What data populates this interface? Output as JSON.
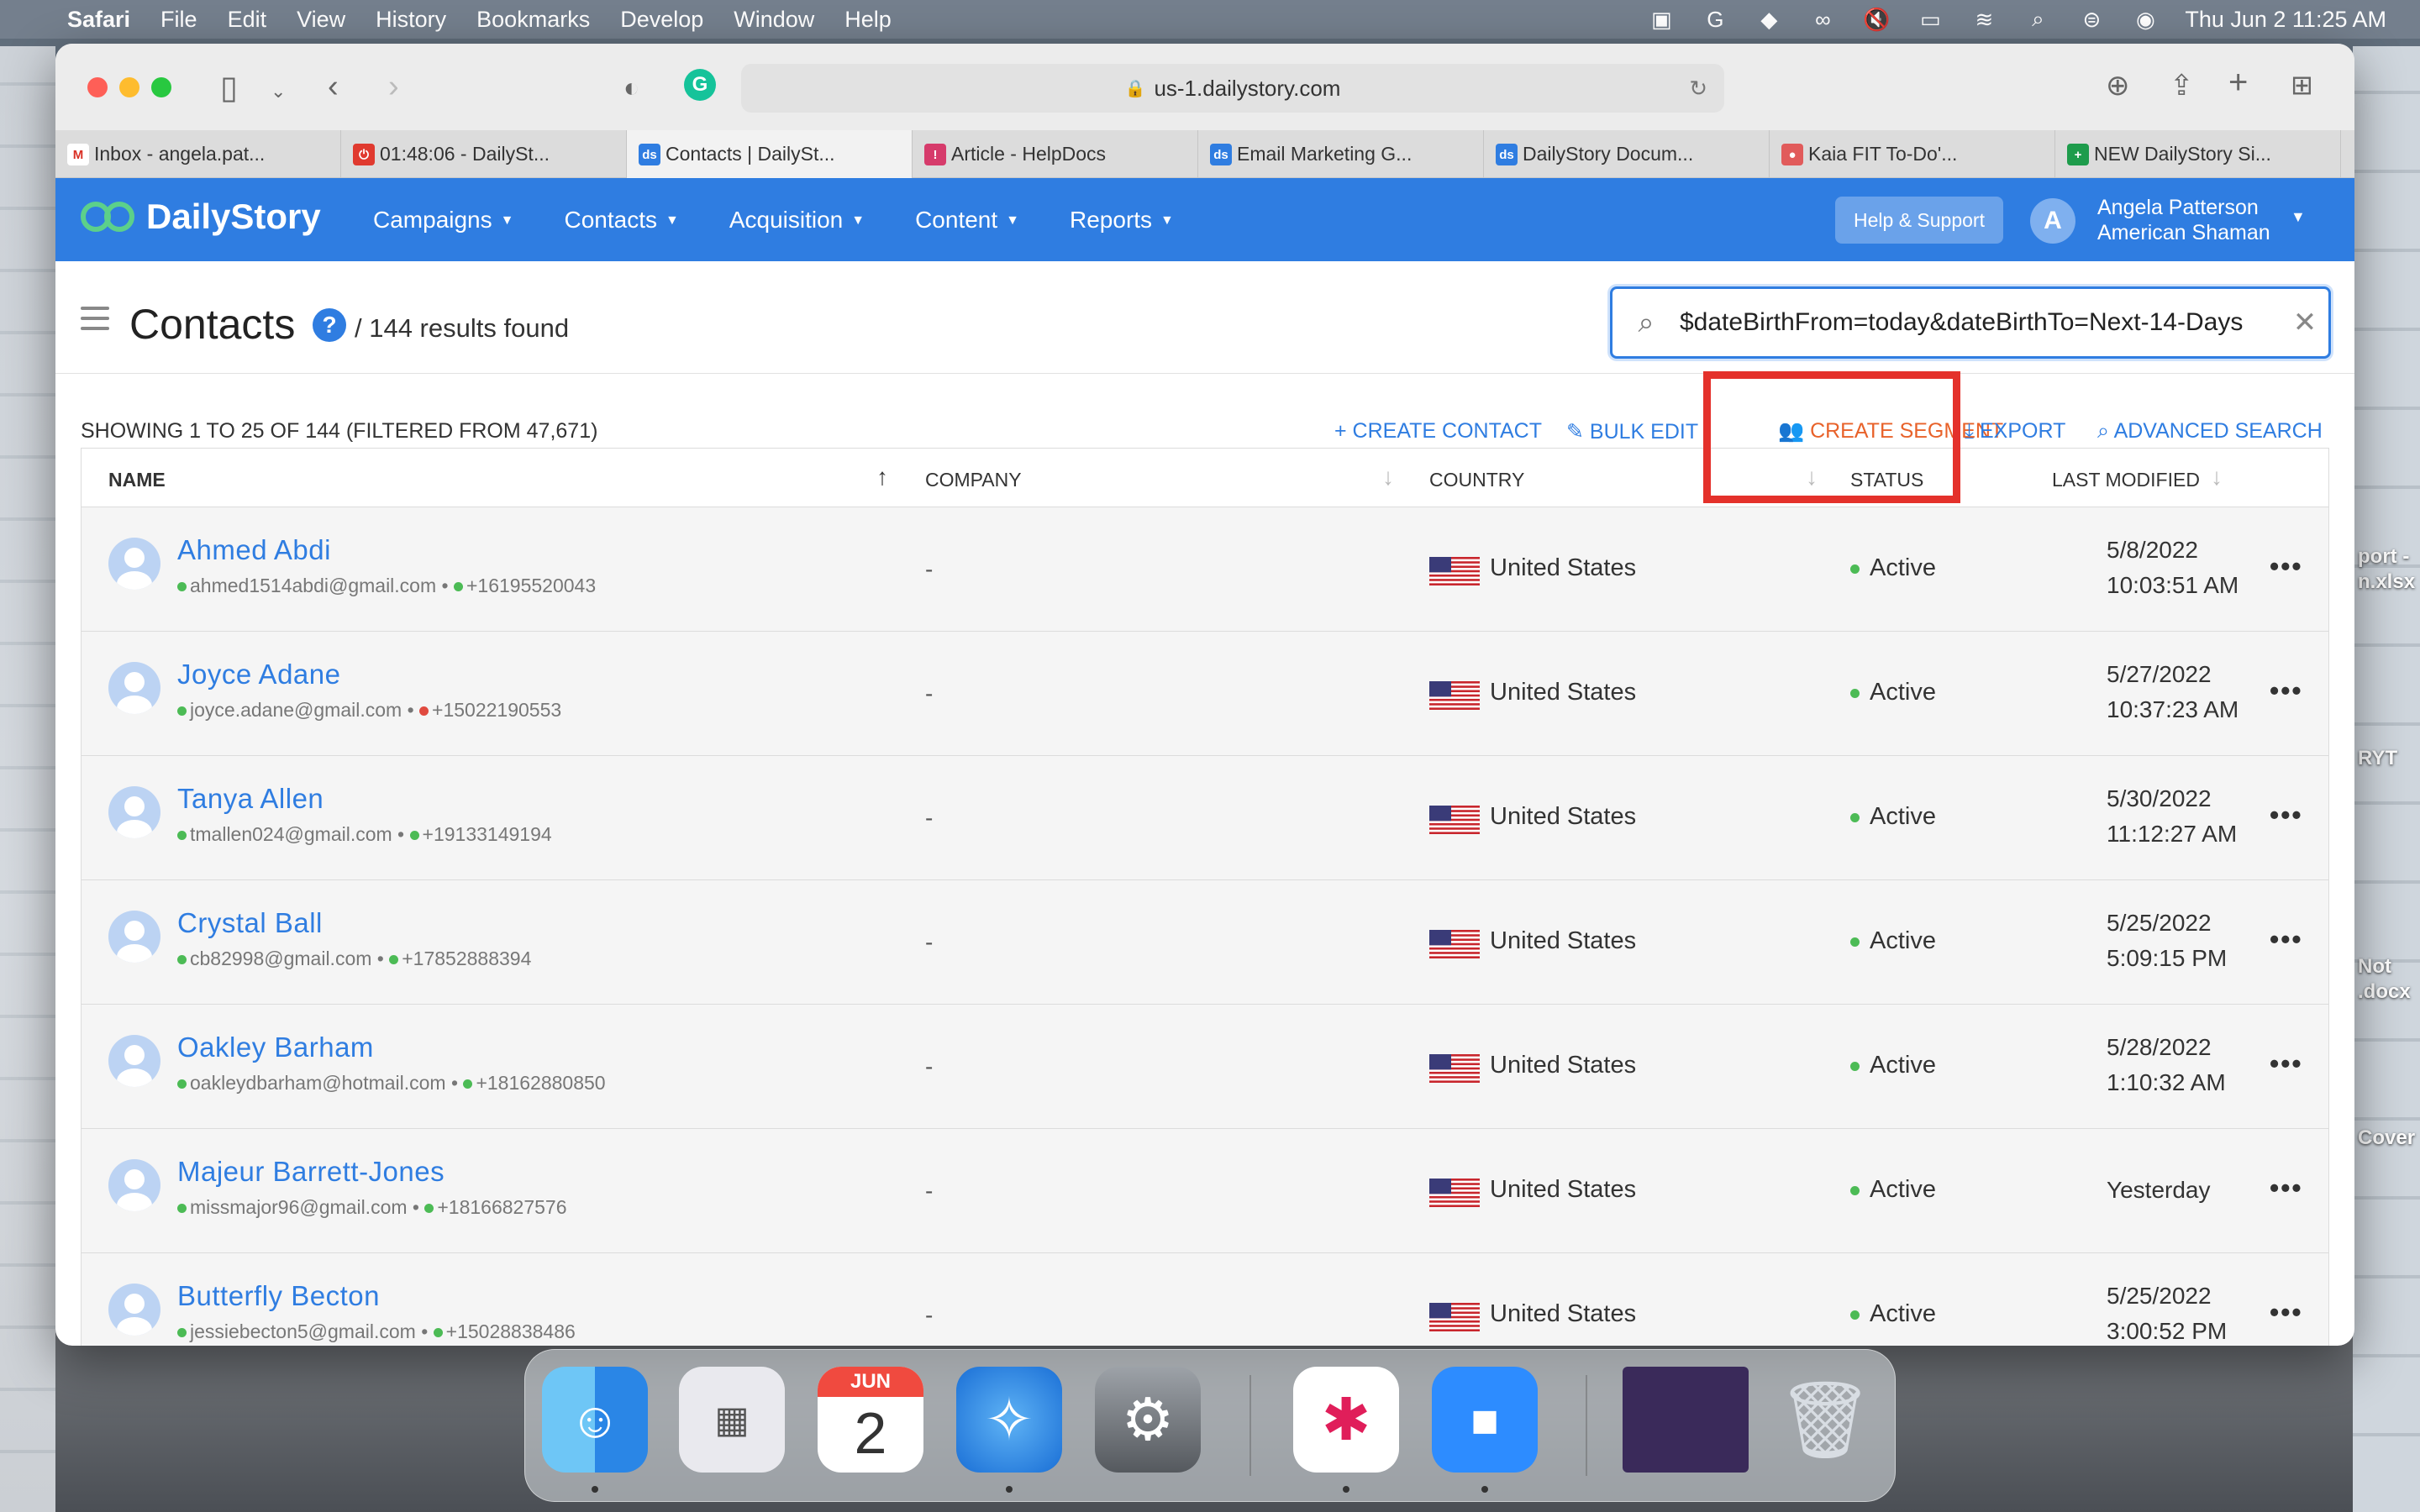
{
  "menubar": {
    "app": "Safari",
    "items": [
      "File",
      "Edit",
      "View",
      "History",
      "Bookmarks",
      "Develop",
      "Window",
      "Help"
    ],
    "clock": "Thu Jun 2  11:25 AM"
  },
  "browser": {
    "url": "us-1.dailystory.com",
    "tabs": [
      {
        "label": "Inbox - angela.pat...",
        "fav": "M",
        "color": "#ffffff"
      },
      {
        "label": "01:48:06 - DailySt...",
        "fav": "⏻",
        "color": "#e03a2f"
      },
      {
        "label": "Contacts | DailySt...",
        "fav": "ds",
        "color": "#2f7de1"
      },
      {
        "label": "Article - HelpDocs",
        "fav": "!",
        "color": "#d63b6b"
      },
      {
        "label": "Email Marketing G...",
        "fav": "ds",
        "color": "#2f7de1"
      },
      {
        "label": "DailyStory Docum...",
        "fav": "ds",
        "color": "#2f7de1"
      },
      {
        "label": "Kaia FIT To-Do'...",
        "fav": "●",
        "color": "#e15b5b"
      },
      {
        "label": "NEW DailyStory Si...",
        "fav": "+",
        "color": "#1e9c4c"
      }
    ]
  },
  "app": {
    "logo": "DailyStory",
    "nav": [
      "Campaigns",
      "Contacts",
      "Acquisition",
      "Content",
      "Reports"
    ],
    "help_button": "Help & Support",
    "user_initial": "A",
    "user_name": "Angela Patterson",
    "user_org": "American Shaman"
  },
  "page": {
    "title": "Contacts",
    "help": "?",
    "results": "/ 144 results found",
    "search_value": "$dateBirthFrom=today&dateBirthTo=Next-14-Days",
    "showing": "SHOWING 1 TO 25 OF 144 (FILTERED FROM 47,671)",
    "actions": {
      "create_contact": "CREATE CONTACT",
      "bulk_edit": "BULK EDIT",
      "create_segment": "CREATE SEGMENT",
      "export": "EXPORT",
      "advanced_search": "ADVANCED SEARCH"
    }
  },
  "table": {
    "columns": {
      "name": "NAME",
      "company": "COMPANY",
      "country": "COUNTRY",
      "status": "STATUS",
      "last_modified": "LAST MODIFIED"
    },
    "rows": [
      {
        "name": "Ahmed Abdi",
        "email": "ahmed1514abdi@gmail.com",
        "phone": "+16195520043",
        "phone_ok": true,
        "company": "-",
        "country": "United States",
        "status": "Active",
        "mod1": "5/8/2022",
        "mod2": "10:03:51 AM"
      },
      {
        "name": "Joyce Adane",
        "email": "joyce.adane@gmail.com",
        "phone": "+15022190553",
        "phone_ok": false,
        "company": "-",
        "country": "United States",
        "status": "Active",
        "mod1": "5/27/2022",
        "mod2": "10:37:23 AM"
      },
      {
        "name": "Tanya Allen",
        "email": "tmallen024@gmail.com",
        "phone": "+19133149194",
        "phone_ok": true,
        "company": "-",
        "country": "United States",
        "status": "Active",
        "mod1": "5/30/2022",
        "mod2": "11:12:27 AM"
      },
      {
        "name": "Crystal Ball",
        "email": "cb82998@gmail.com",
        "phone": "+17852888394",
        "phone_ok": true,
        "company": "-",
        "country": "United States",
        "status": "Active",
        "mod1": "5/25/2022",
        "mod2": "5:09:15 PM"
      },
      {
        "name": "Oakley Barham",
        "email": "oakleydbarham@hotmail.com",
        "phone": "+18162880850",
        "phone_ok": true,
        "company": "-",
        "country": "United States",
        "status": "Active",
        "mod1": "5/28/2022",
        "mod2": "1:10:32 AM"
      },
      {
        "name": "Majeur Barrett-Jones",
        "email": "missmajor96@gmail.com",
        "phone": "+18166827576",
        "phone_ok": true,
        "company": "-",
        "country": "United States",
        "status": "Active",
        "mod1": "Yesterday",
        "mod2": ""
      },
      {
        "name": "Butterfly Becton",
        "email": "jessiebecton5@gmail.com",
        "phone": "+15028838486",
        "phone_ok": true,
        "company": "-",
        "country": "United States",
        "status": "Active",
        "mod1": "5/25/2022",
        "mod2": "3:00:52 PM"
      }
    ]
  },
  "desktop": {
    "labels": [
      "port -",
      "n.xlsx",
      "RYT",
      "Not",
      ".docx",
      "Cover"
    ]
  },
  "dock": {
    "calendar_month": "JUN",
    "calendar_day": "2"
  },
  "colors": {
    "brand": "#2f7de1",
    "accent_orange": "#e8622a",
    "highlight_red": "#e4312b"
  }
}
